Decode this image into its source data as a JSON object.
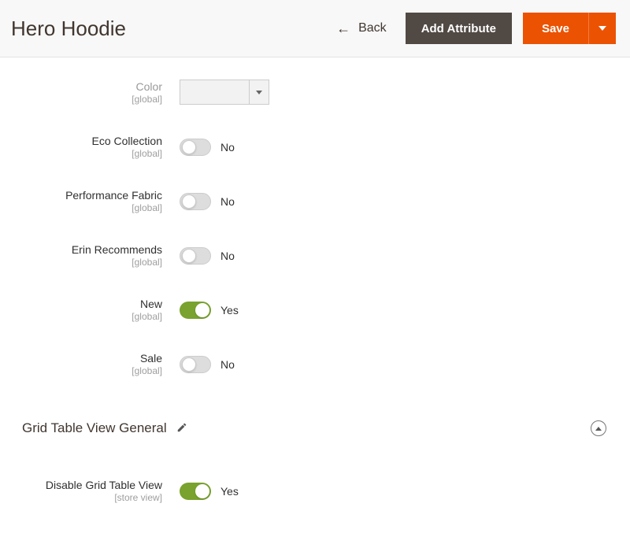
{
  "header": {
    "title": "Hero Hoodie",
    "back_label": "Back",
    "add_attribute_label": "Add Attribute",
    "save_label": "Save"
  },
  "scope_global": "[global]",
  "scope_store_view": "[store view]",
  "toggle_on_text": "Yes",
  "toggle_off_text": "No",
  "fields": {
    "color": {
      "label": "Color"
    },
    "eco_collection": {
      "label": "Eco Collection",
      "value": false
    },
    "performance_fabric": {
      "label": "Performance Fabric",
      "value": false
    },
    "erin_recommends": {
      "label": "Erin Recommends",
      "value": false
    },
    "new": {
      "label": "New",
      "value": true
    },
    "sale": {
      "label": "Sale",
      "value": false
    }
  },
  "section": {
    "title": "Grid Table View General",
    "disable_grid": {
      "label": "Disable Grid Table View",
      "value": true
    }
  }
}
